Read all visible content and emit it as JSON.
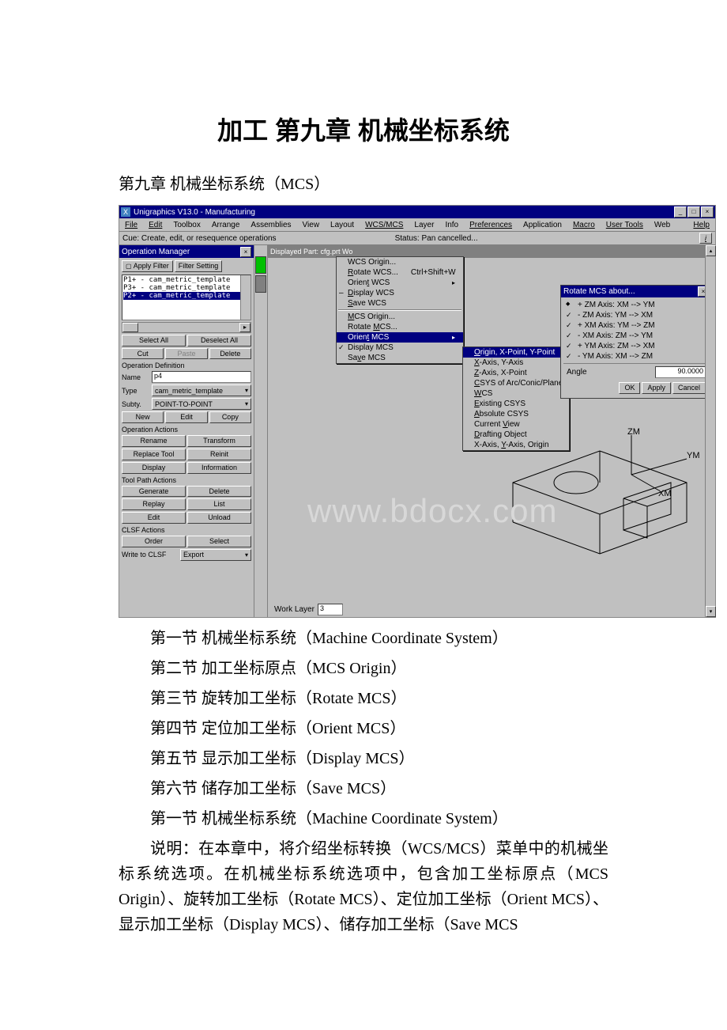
{
  "doc": {
    "title": "加工 第九章 机械坐标系统",
    "chapter": "第九章 机械坐标系统（MCS）",
    "sections": [
      "第一节 机械坐标系统（Machine Coordinate System）",
      "第二节 加工坐标原点（MCS Origin）",
      "第三节 旋转加工坐标（Rotate MCS）",
      "第四节 定位加工坐标（Orient MCS）",
      "第五节 显示加工坐标（Display MCS）",
      "第六节 储存加工坐标（Save MCS）"
    ],
    "section1_heading": "第一节 机械坐标系统（Machine Coordinate System）",
    "paragraph": "说明：在本章中，将介绍坐标转换（WCS/MCS）菜单中的机械坐标系统选项。在机械坐标系统选项中，包含加工坐标原点（MCS Origin）、旋转加工坐标（Rotate MCS）、定位加工坐标（Orient MCS）、显示加工坐标（Display MCS）、储存加工坐标（Save MCS"
  },
  "shot": {
    "title": "Unigraphics V13.0 - Manufacturing",
    "menubar": [
      "File",
      "Edit",
      "Toolbox",
      "Arrange",
      "Assemblies",
      "View",
      "Layout",
      "WCS/MCS",
      "Layer",
      "Info",
      "Preferences",
      "Application",
      "Macro",
      "User Tools",
      "Web"
    ],
    "help": "Help",
    "cue": "Cue: Create, edit, or resequence operations",
    "status": "Status:   Pan cancelled...",
    "info_icon": "i",
    "om": {
      "title": "Operation Manager",
      "apply_filter": "Apply Filter",
      "filter_setting": "Filter Setting",
      "list": [
        "P1+ - cam_metric_template",
        "P3+ - cam_metric_template",
        "P2+ - cam_metric_template"
      ],
      "select_all": "Select All",
      "deselect_all": "Deselect All",
      "cut": "Cut",
      "paste": "Paste",
      "delete": "Delete",
      "opdef": "Operation Definition",
      "name_lbl": "Name",
      "name_val": "p4",
      "type_lbl": "Type",
      "type_val": "cam_metric_template",
      "subty_lbl": "Subty.",
      "subty_val": "POINT-TO-POINT",
      "new": "New",
      "edit": "Edit",
      "copy": "Copy",
      "opact": "Operation Actions",
      "rename": "Rename",
      "transform": "Transform",
      "replace_tool": "Replace Tool",
      "reinit": "Reinit",
      "display": "Display",
      "information": "Information",
      "tpa": "Tool Path Actions",
      "generate": "Generate",
      "tpa_delete": "Delete",
      "replay": "Replay",
      "list_btn": "List",
      "tpa_edit": "Edit",
      "unload": "Unload",
      "clsf": "CLSF Actions",
      "order": "Order",
      "select": "Select",
      "write_clsf": "Write to CLSF",
      "export": "Export"
    },
    "canvas_title": "Displayed Part: cfg.prt   Wo",
    "wcs_menu": {
      "items": [
        {
          "label": "WCS Origin..."
        },
        {
          "label": "Rotate WCS...",
          "shortcut": "Ctrl+Shift+W"
        },
        {
          "label": "Orient WCS",
          "sub": true
        },
        {
          "label": "Display WCS",
          "check": "dash"
        },
        {
          "label": "Save WCS"
        },
        {
          "sep": true
        },
        {
          "label": "MCS Origin..."
        },
        {
          "label": "Rotate MCS..."
        },
        {
          "label": "Orient MCS",
          "sub": true,
          "hi": true
        },
        {
          "label": "Display MCS",
          "check": "check"
        },
        {
          "label": "Save MCS"
        }
      ]
    },
    "orient_sub": {
      "items": [
        "Origin, X-Point, Y-Point",
        "X-Axis, Y-Axis",
        "Z-Axis, X-Point",
        "CSYS of Arc/Conic/Plane",
        "WCS",
        "Existing CSYS",
        "Absolute CSYS",
        "Current View",
        "Drafting Object",
        "X-Axis, Y-Axis, Origin"
      ]
    },
    "rotate_dialog": {
      "title": "Rotate MCS about...",
      "opts": [
        {
          "t": "+ ZM Axis:  XM --> YM",
          "c": "pt"
        },
        {
          "t": "- ZM Axis:  YM --> XM",
          "c": "ch"
        },
        {
          "t": "+ XM Axis:  YM --> ZM",
          "c": "ch"
        },
        {
          "t": "- XM Axis:  ZM --> YM",
          "c": "ch"
        },
        {
          "t": "+ YM Axis:  ZM --> XM",
          "c": "ch"
        },
        {
          "t": "- YM Axis:  XM --> ZM",
          "c": "ch"
        }
      ],
      "angle_lbl": "Angle",
      "angle_val": "90.0000",
      "ok": "OK",
      "apply": "Apply",
      "cancel": "Cancel"
    },
    "axes": {
      "zm": "ZM",
      "ym": "YM",
      "xm": "XM"
    },
    "work_layer_lbl": "Work Layer",
    "work_layer_val": "3",
    "watermark": "www.bdocx.com"
  }
}
